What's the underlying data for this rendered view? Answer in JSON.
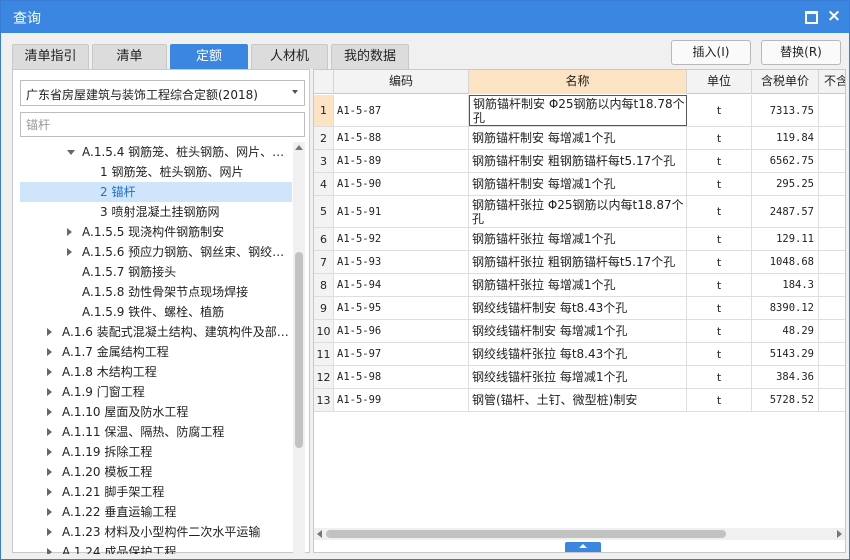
{
  "window": {
    "title": "查询"
  },
  "tabs": [
    {
      "label": "清单指引",
      "active": false
    },
    {
      "label": "清单",
      "active": false
    },
    {
      "label": "定额",
      "active": true
    },
    {
      "label": "人材机",
      "active": false
    },
    {
      "label": "我的数据",
      "active": false
    }
  ],
  "toolbar": {
    "insert_label": "插入(I)",
    "replace_label": "替换(R)"
  },
  "left": {
    "library_select": "广东省房屋建筑与装饰工程综合定额(2018)",
    "search_placeholder": "锚杆",
    "tree": [
      {
        "label": "A.1.5.4 钢筋笼、桩头钢筋、网片、…",
        "level": 2,
        "toggle": "expanded",
        "selected": false
      },
      {
        "label": "1 钢筋笼、桩头钢筋、网片",
        "level": 3,
        "toggle": "none",
        "selected": false
      },
      {
        "label": "2 锚杆",
        "level": 3,
        "toggle": "none",
        "selected": true
      },
      {
        "label": "3 喷射混凝土挂钢筋网",
        "level": 3,
        "toggle": "none",
        "selected": false
      },
      {
        "label": "A.1.5.5 现浇构件钢筋制安",
        "level": 2,
        "toggle": "collapsed",
        "selected": false
      },
      {
        "label": "A.1.5.6 预应力钢筋、钢丝束、钢绞…",
        "level": 2,
        "toggle": "collapsed",
        "selected": false
      },
      {
        "label": "A.1.5.7 钢筋接头",
        "level": 2,
        "toggle": "none",
        "selected": false
      },
      {
        "label": "A.1.5.8 劲性骨架节点现场焊接",
        "level": 2,
        "toggle": "none",
        "selected": false
      },
      {
        "label": "A.1.5.9 铁件、螺栓、植筋",
        "level": 2,
        "toggle": "none",
        "selected": false
      },
      {
        "label": "A.1.6 装配式混凝土结构、建筑构件及部…",
        "level": 1,
        "toggle": "collapsed",
        "selected": false
      },
      {
        "label": "A.1.7 金属结构工程",
        "level": 1,
        "toggle": "collapsed",
        "selected": false
      },
      {
        "label": "A.1.8 木结构工程",
        "level": 1,
        "toggle": "collapsed",
        "selected": false
      },
      {
        "label": "A.1.9 门窗工程",
        "level": 1,
        "toggle": "collapsed",
        "selected": false
      },
      {
        "label": "A.1.10 屋面及防水工程",
        "level": 1,
        "toggle": "collapsed",
        "selected": false
      },
      {
        "label": "A.1.11 保温、隔热、防腐工程",
        "level": 1,
        "toggle": "collapsed",
        "selected": false
      },
      {
        "label": "A.1.19 拆除工程",
        "level": 1,
        "toggle": "collapsed",
        "selected": false
      },
      {
        "label": "A.1.20 模板工程",
        "level": 1,
        "toggle": "collapsed",
        "selected": false
      },
      {
        "label": "A.1.21 脚手架工程",
        "level": 1,
        "toggle": "collapsed",
        "selected": false
      },
      {
        "label": "A.1.22 垂直运输工程",
        "level": 1,
        "toggle": "collapsed",
        "selected": false
      },
      {
        "label": "A.1.23 材料及小型构件二次水平运输",
        "level": 1,
        "toggle": "collapsed",
        "selected": false
      },
      {
        "label": "A.1.24 成品保护工程",
        "level": 1,
        "toggle": "collapsed",
        "selected": false
      }
    ]
  },
  "grid": {
    "columns": [
      "",
      "编码",
      "名称",
      "单位",
      "含税单价",
      "不含"
    ],
    "rows": [
      {
        "n": "1",
        "code": "A1-5-87",
        "name": "钢筋锚杆制安  Φ25钢筋以内每t18.78个孔",
        "unit": "t",
        "price": "7313.75"
      },
      {
        "n": "2",
        "code": "A1-5-88",
        "name": "钢筋锚杆制安 每增减1个孔",
        "unit": "t",
        "price": "119.84"
      },
      {
        "n": "3",
        "code": "A1-5-89",
        "name": "钢筋锚杆制安 粗钢筋锚杆每t5.17个孔",
        "unit": "t",
        "price": "6562.75"
      },
      {
        "n": "4",
        "code": "A1-5-90",
        "name": "钢筋锚杆制安 每增减1个孔",
        "unit": "t",
        "price": "295.25"
      },
      {
        "n": "5",
        "code": "A1-5-91",
        "name": "钢筋锚杆张拉  Φ25钢筋以内每t18.87个孔",
        "unit": "t",
        "price": "2487.57"
      },
      {
        "n": "6",
        "code": "A1-5-92",
        "name": "钢筋锚杆张拉 每增减1个孔",
        "unit": "t",
        "price": "129.11"
      },
      {
        "n": "7",
        "code": "A1-5-93",
        "name": "钢筋锚杆张拉 粗钢筋锚杆每t5.17个孔",
        "unit": "t",
        "price": "1048.68"
      },
      {
        "n": "8",
        "code": "A1-5-94",
        "name": "钢筋锚杆张拉 每增减1个孔",
        "unit": "t",
        "price": "184.3"
      },
      {
        "n": "9",
        "code": "A1-5-95",
        "name": "钢绞线锚杆制安 每t8.43个孔",
        "unit": "t",
        "price": "8390.12"
      },
      {
        "n": "10",
        "code": "A1-5-96",
        "name": "钢绞线锚杆制安 每增减1个孔",
        "unit": "t",
        "price": "48.29"
      },
      {
        "n": "11",
        "code": "A1-5-97",
        "name": "钢绞线锚杆张拉 每t8.43个孔",
        "unit": "t",
        "price": "5143.29"
      },
      {
        "n": "12",
        "code": "A1-5-98",
        "name": "钢绞线锚杆张拉 每增减1个孔",
        "unit": "t",
        "price": "384.36"
      },
      {
        "n": "13",
        "code": "A1-5-99",
        "name": "钢管(锚杆、土钉、微型桩)制安",
        "unit": "t",
        "price": "5728.52"
      }
    ]
  },
  "icons": {
    "maximize": "maximize-icon",
    "close": "close-icon",
    "close_glyph": "×"
  },
  "colors": {
    "accent": "#3b86e0",
    "selection": "#cfe5fb",
    "header_highlight": "#fbe3c3"
  }
}
